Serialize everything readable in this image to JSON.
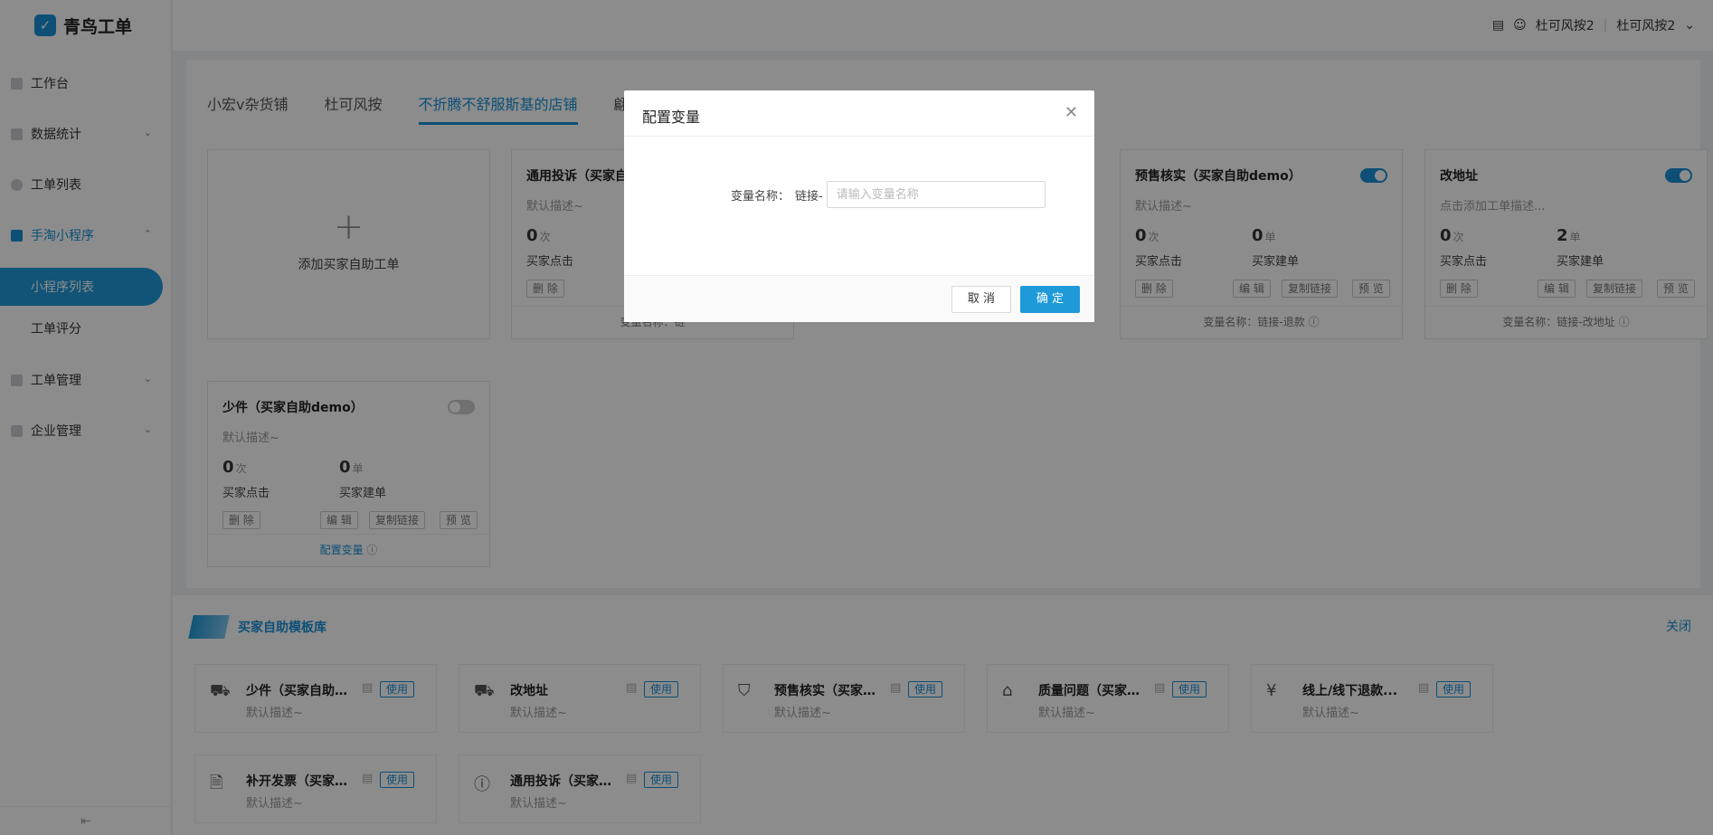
{
  "app": {
    "title": "青鸟工单"
  },
  "sidebar": {
    "items": [
      {
        "label": "工作台"
      },
      {
        "label": "数据统计"
      },
      {
        "label": "工单列表"
      },
      {
        "label": "手淘小程序"
      },
      {
        "label": "小程序列表"
      },
      {
        "label": "工单评分"
      },
      {
        "label": "工单管理"
      },
      {
        "label": "企业管理"
      }
    ],
    "collapse_icon": "collapse-icon"
  },
  "header": {
    "user": "杜可风按2",
    "shop": "杜可风按2"
  },
  "tabs": [
    "小宏v杂货铺",
    "杜可风按",
    "不折腾不舒服斯基的店铺",
    "翩翩"
  ],
  "add_card": {
    "label": "添加买家自助工单"
  },
  "cards": [
    {
      "title": "通用投诉（买家自助",
      "desc": "默认描述~",
      "clicks": "0",
      "clicks_unit": "次",
      "clicks_label": "买家点击",
      "delete": "删 除",
      "footer": "变量名称：链"
    },
    {
      "title": "预售核实（买家自助demo）",
      "desc": "默认描述~",
      "clicks": "0",
      "clicks_unit": "次",
      "clicks_label": "买家点击",
      "orders": "0",
      "orders_unit": "单",
      "orders_label": "买家建单",
      "delete": "删 除",
      "edit": "编 辑",
      "copy": "复制链接",
      "preview": "预 览",
      "footer": "变量名称：链接-退款"
    },
    {
      "title": "改地址",
      "desc": "点击添加工单描述...",
      "clicks": "0",
      "clicks_unit": "次",
      "clicks_label": "买家点击",
      "orders": "2",
      "orders_unit": "单",
      "orders_label": "买家建单",
      "delete": "删 除",
      "edit": "编 辑",
      "copy": "复制链接",
      "preview": "预 览",
      "footer": "变量名称：链接-改地址"
    },
    {
      "title": "少件（买家自助demo）",
      "desc": "默认描述~",
      "clicks": "0",
      "clicks_unit": "次",
      "clicks_label": "买家点击",
      "orders": "0",
      "orders_unit": "单",
      "orders_label": "买家建单",
      "delete": "删 除",
      "edit": "编 辑",
      "copy": "复制链接",
      "preview": "预 览",
      "footer": "配置变量"
    }
  ],
  "templates": {
    "title": "买家自助模板库",
    "close": "关闭",
    "use_label": "使用",
    "items": [
      {
        "name": "少件（买家自助...",
        "desc": "默认描述~",
        "icon": "truck-icon"
      },
      {
        "name": "改地址",
        "desc": "默认描述~",
        "icon": "truck-icon"
      },
      {
        "name": "预售核实（买家...",
        "desc": "默认描述~",
        "icon": "bag-icon"
      },
      {
        "name": "质量问题（买家...",
        "desc": "默认描述~",
        "icon": "house-icon"
      },
      {
        "name": "线上/线下退款...",
        "desc": "默认描述~",
        "icon": "yen-icon"
      },
      {
        "name": "补开发票（买家...",
        "desc": "默认描述~",
        "icon": "receipt-icon"
      },
      {
        "name": "通用投诉（买家...",
        "desc": "默认描述~",
        "icon": "info-icon"
      }
    ]
  },
  "modal": {
    "title": "配置变量",
    "label": "变量名称：",
    "prefix": "链接-",
    "placeholder": "请输入变量名称",
    "cancel": "取 消",
    "ok": "确 定"
  }
}
